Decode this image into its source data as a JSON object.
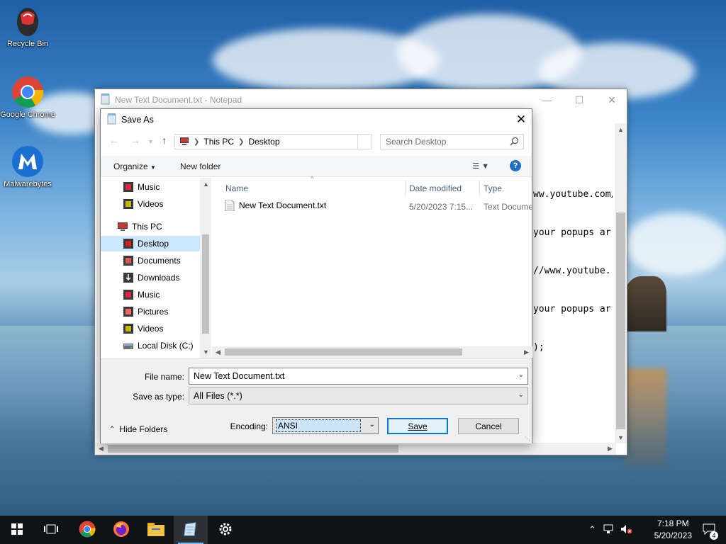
{
  "desktop": {
    "icons": [
      {
        "label": "Recycle Bin",
        "icon": "recycle-bin-icon"
      },
      {
        "label": "Google Chrome",
        "icon": "chrome-icon"
      },
      {
        "label": "Malwarebytes",
        "icon": "malwarebytes-icon"
      }
    ]
  },
  "notepad": {
    "title": "New Text Document.txt - Notepad",
    "lines": [
      "ww.youtube.com/w",
      "your popups ar",
      "//www.youtube.",
      "your popups ar",
      ");"
    ]
  },
  "dialog": {
    "title": "Save As",
    "breadcrumb": [
      "This PC",
      "Desktop"
    ],
    "search_placeholder": "Search Desktop",
    "commands": {
      "organize": "Organize",
      "new_folder": "New folder"
    },
    "nav_items": [
      {
        "label": "Music",
        "icon": "music-folder-icon"
      },
      {
        "label": "Videos",
        "icon": "videos-folder-icon"
      },
      {
        "label": "This PC",
        "icon": "this-pc-icon"
      },
      {
        "label": "Desktop",
        "icon": "desktop-folder-icon"
      },
      {
        "label": "Documents",
        "icon": "documents-folder-icon"
      },
      {
        "label": "Downloads",
        "icon": "downloads-folder-icon"
      },
      {
        "label": "Music",
        "icon": "music-folder-icon"
      },
      {
        "label": "Pictures",
        "icon": "pictures-folder-icon"
      },
      {
        "label": "Videos",
        "icon": "videos-folder-icon"
      },
      {
        "label": "Local Disk (C:)",
        "icon": "local-disk-icon"
      }
    ],
    "columns": [
      "Name",
      "Date modified",
      "Type"
    ],
    "files": [
      {
        "name": "New Text Document.txt",
        "date": "5/20/2023 7:15...",
        "type": "Text Document"
      }
    ],
    "file_name_label": "File name:",
    "file_name_value": "New Text Document.txt",
    "save_type_label": "Save as type:",
    "save_type_value": "All Files  (*.*)",
    "encoding_label": "Encoding:",
    "encoding_value": "ANSI",
    "save_button": "Save",
    "cancel_button": "Cancel",
    "hide_folders": "Hide Folders"
  },
  "taskbar": {
    "apps": [
      "start-icon",
      "task-view-icon",
      "chrome-icon",
      "firefox-icon",
      "file-explorer-icon",
      "notepad-icon",
      "settings-icon"
    ],
    "time": "7:18 PM",
    "date": "5/20/2023",
    "notification_count": "4"
  }
}
